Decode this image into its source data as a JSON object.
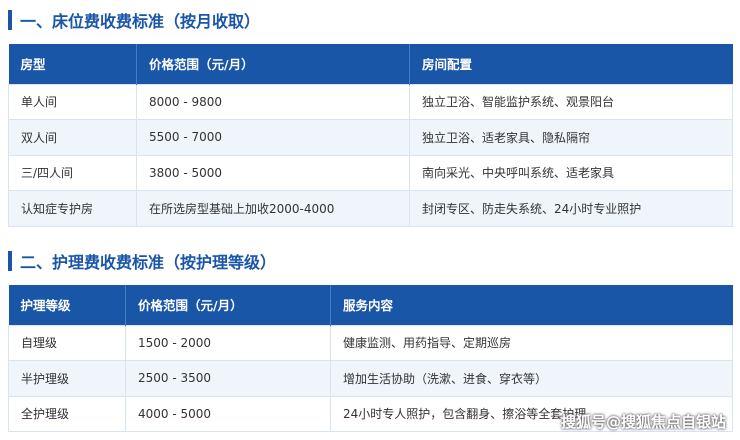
{
  "section1": {
    "title": "一、床位费收费标准（按月收取）",
    "headers": [
      "房型",
      "价格范围（元/月）",
      "房间配置"
    ],
    "rows": [
      [
        "单人间",
        "8000 - 9800",
        "独立卫浴、智能监护系统、观景阳台"
      ],
      [
        "双人间",
        "5500 - 7000",
        "独立卫浴、适老家具、隐私隔帘"
      ],
      [
        "三/四人间",
        "3800 - 5000",
        "南向采光、中央呼叫系统、适老家具"
      ],
      [
        "认知症专护房",
        "在所选房型基础上加收2000-4000",
        "封闭专区、防走失系统、24小时专业照护"
      ]
    ]
  },
  "section2": {
    "title": "二、护理费收费标准（按护理等级）",
    "headers": [
      "护理等级",
      "价格范围（元/月）",
      "服务内容"
    ],
    "rows": [
      [
        "自理级",
        "1500 - 2000",
        "健康监测、用药指导、定期巡房"
      ],
      [
        "半护理级",
        "2500 - 3500",
        "增加生活协助（洗漱、进食、穿衣等）"
      ],
      [
        "全护理级",
        "4000 - 5000",
        "24小时专人照护，包含翻身、擦浴等全套护理"
      ]
    ]
  },
  "watermark": "搜狐号@搜狐焦点自银站",
  "colors": {
    "accent": "#1a56a8",
    "row_alt": "#f0f5fb",
    "border": "#d9e4f2"
  }
}
